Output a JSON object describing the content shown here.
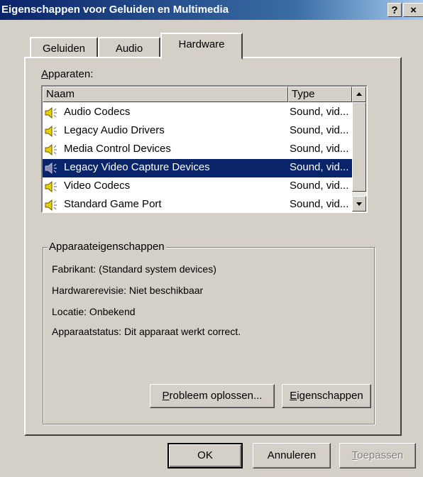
{
  "window": {
    "title": "Eigenschappen voor Geluiden en Multimedia",
    "help_label": "?",
    "close_label": "×"
  },
  "tabs": [
    {
      "label": "Geluiden",
      "active": false
    },
    {
      "label": "Audio",
      "active": false
    },
    {
      "label": "Hardware",
      "active": true
    }
  ],
  "devices": {
    "label_accel": "A",
    "label_rest": "pparaten:",
    "columns": {
      "name": "Naam",
      "type": "Type"
    },
    "items": [
      {
        "name": "Audio Codecs",
        "type": "Sound, vid...",
        "icon": "speaker-icon",
        "selected": false
      },
      {
        "name": "Legacy Audio Drivers",
        "type": "Sound, vid...",
        "icon": "speaker-icon",
        "selected": false
      },
      {
        "name": "Media Control Devices",
        "type": "Sound, vid...",
        "icon": "speaker-icon",
        "selected": false
      },
      {
        "name": "Legacy Video Capture Devices",
        "type": "Sound, vid...",
        "icon": "speaker-icon",
        "selected": true
      },
      {
        "name": "Video Codecs",
        "type": "Sound, vid...",
        "icon": "speaker-icon",
        "selected": false
      },
      {
        "name": "Standard Game Port",
        "type": "Sound, vid...",
        "icon": "speaker-icon",
        "selected": false
      }
    ]
  },
  "properties": {
    "title": "Apparaateigenschappen",
    "manufacturer": "Fabrikant: (Standard system devices)",
    "hardware_revision": "Hardwarerevisie: Niet beschikbaar",
    "location": "Locatie: Onbekend",
    "status": "Apparaatstatus: Dit apparaat werkt correct.",
    "troubleshoot_accel": "P",
    "troubleshoot_rest": "robleem oplossen...",
    "properties_accel": "E",
    "properties_rest": "igenschappen"
  },
  "footer": {
    "ok_label": "OK",
    "cancel_label": "Annuleren",
    "apply_accel": "T",
    "apply_rest": "oepassen"
  },
  "colors": {
    "titlebar_start": "#0a246a",
    "selection": "#0a246a",
    "face": "#d4d0c8"
  }
}
